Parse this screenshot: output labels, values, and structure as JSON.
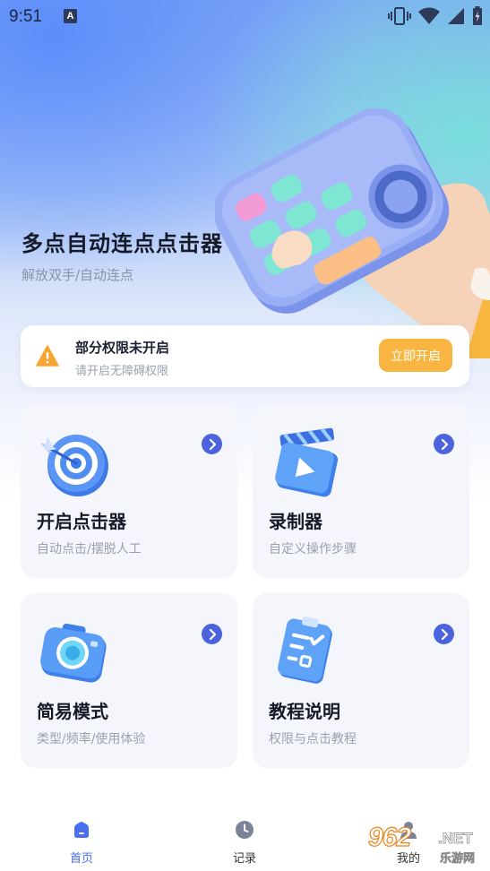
{
  "status_bar": {
    "time": "9:51",
    "notification_icon": "A"
  },
  "hero": {
    "title": "多点自动连点点击器",
    "subtitle": "解放双手/自动连点"
  },
  "permission": {
    "title": "部分权限未开启",
    "subtitle": "请开启无障碍权限",
    "button": "立即开启"
  },
  "cards": [
    {
      "title": "开启点击器",
      "subtitle": "自动点击/摆脱人工",
      "icon": "target-icon"
    },
    {
      "title": "录制器",
      "subtitle": "自定义操作步骤",
      "icon": "clapperboard-icon"
    },
    {
      "title": "简易模式",
      "subtitle": "类型/频率/使用体验",
      "icon": "camera-icon"
    },
    {
      "title": "教程说明",
      "subtitle": "权限与点击教程",
      "icon": "checklist-icon"
    }
  ],
  "nav": {
    "items": [
      {
        "label": "首页",
        "icon": "home-icon",
        "active": true
      },
      {
        "label": "记录",
        "icon": "clock-icon",
        "active": false
      },
      {
        "label": "我的",
        "icon": "profile-icon",
        "active": false
      }
    ]
  },
  "watermark": {
    "main": "962",
    "net": ".NET",
    "sub": "乐游网"
  },
  "colors": {
    "accent": "#4c63dd",
    "warning": "#f8b542",
    "nav_active": "#4a6ef0"
  }
}
